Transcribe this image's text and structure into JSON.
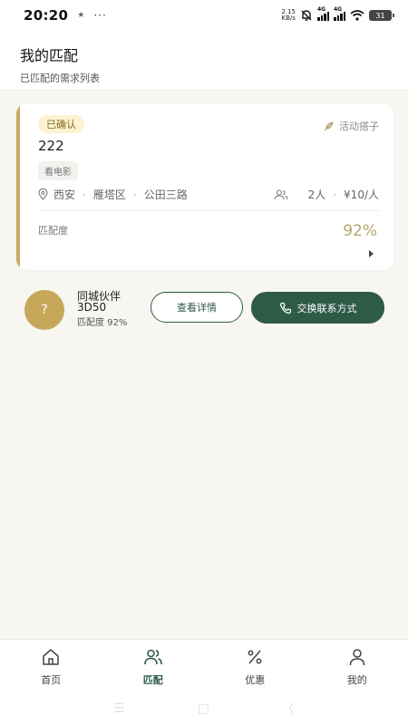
{
  "status_bar": {
    "time": "20:20",
    "net_speed_value": "2.15",
    "net_speed_unit": "KB/s",
    "signal_1_label": "4G",
    "signal_2_label": "4G",
    "battery_level": "31"
  },
  "header": {
    "title": "我的匹配",
    "subtitle": "已匹配的需求列表"
  },
  "match_card": {
    "status": "已确认",
    "activity_type": "活动搭子",
    "title": "222",
    "category": "看电影",
    "location": {
      "city": "西安",
      "district": "雁塔区",
      "street": "公田三路"
    },
    "people": "2人",
    "price": "¥10/人",
    "score_label": "匹配度",
    "score": "92%",
    "score_fraction": 0.92
  },
  "partner": {
    "avatar": "?",
    "name": "同城伙伴",
    "id": "3D50",
    "score": "匹配度 92%",
    "detail_button": "查看详情",
    "contact_button": "交换联系方式"
  },
  "bottom_nav": [
    {
      "label": "首页",
      "icon": "home-icon",
      "active": false
    },
    {
      "label": "匹配",
      "icon": "users-icon",
      "active": true
    },
    {
      "label": "优惠",
      "icon": "percent-icon",
      "active": false
    },
    {
      "label": "我的",
      "icon": "user-icon",
      "active": false
    }
  ],
  "colors": {
    "accent_gold": "#c8ab62",
    "primary_green": "#2e5a48",
    "badge_bg": "#fbf3d2",
    "score_color": "#b5a56a"
  }
}
